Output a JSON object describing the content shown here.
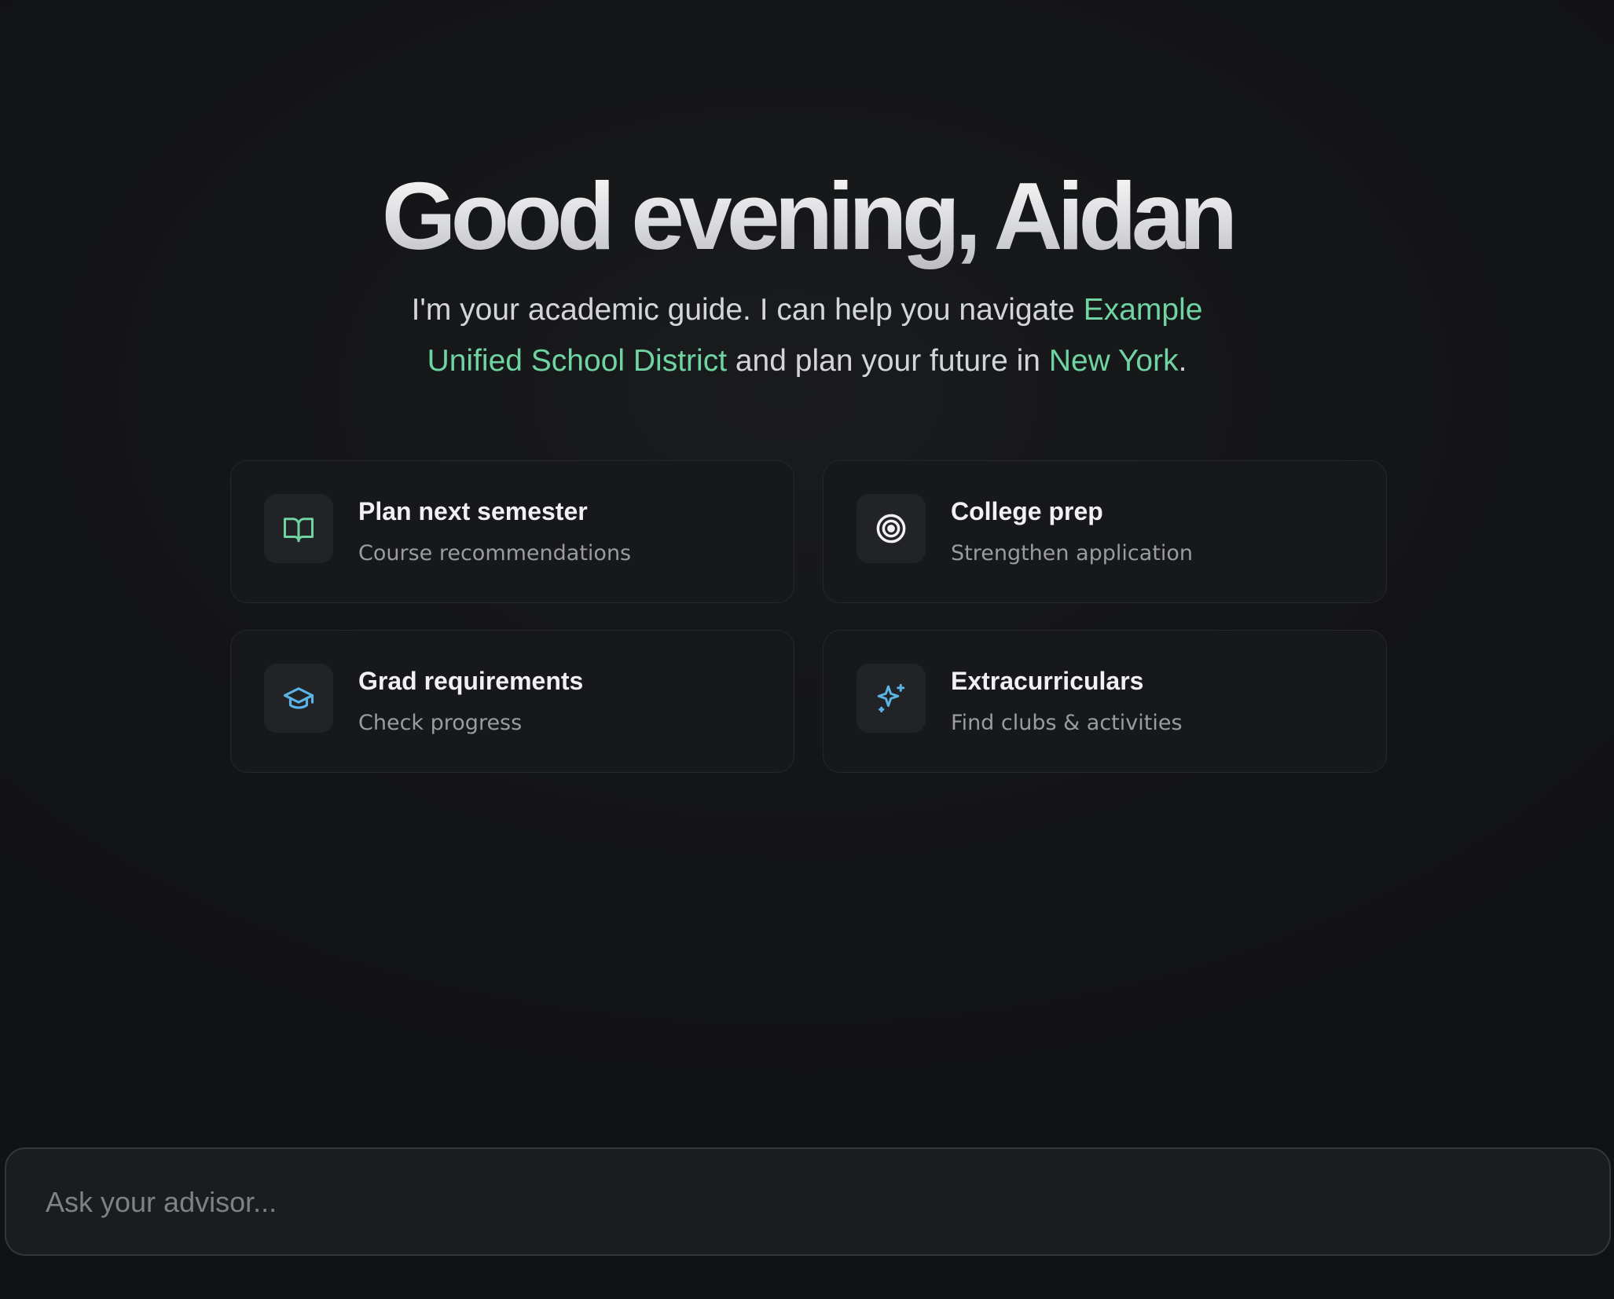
{
  "greeting": {
    "title": "Good evening, Aidan"
  },
  "intro": {
    "part1": "I'm your academic guide. I can help you navigate ",
    "district": "Example Unified School District",
    "part2": " and plan your future in ",
    "location": "New York",
    "part3": "."
  },
  "cards": [
    {
      "title": "Plan next semester",
      "subtitle": "Course recommendations",
      "icon": "book-open-icon"
    },
    {
      "title": "College prep",
      "subtitle": "Strengthen application",
      "icon": "target-icon"
    },
    {
      "title": "Grad requirements",
      "subtitle": "Check progress",
      "icon": "graduation-cap-icon"
    },
    {
      "title": "Extracurriculars",
      "subtitle": "Find clubs & activities",
      "icon": "sparkles-icon"
    }
  ],
  "ask": {
    "placeholder": "Ask your advisor..."
  },
  "colors": {
    "background": "#121315",
    "accent_green": "#6fd4a2",
    "accent_blue": "#5ab4e6",
    "card_bg": "#17181b"
  }
}
